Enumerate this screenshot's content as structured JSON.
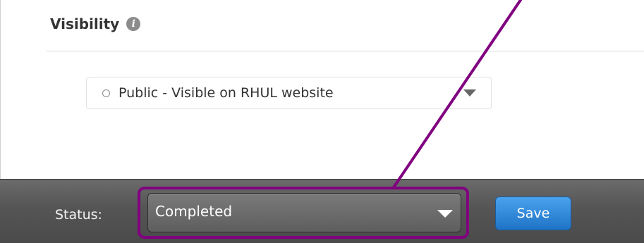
{
  "visibility": {
    "heading": "Visibility",
    "info_icon": "info-icon",
    "selected": "Public - Visible on RHUL website",
    "caret_icon": "chevron-down-icon"
  },
  "status_bar": {
    "label": "Status:",
    "selected": "Completed",
    "caret_icon": "chevron-down-icon",
    "save_label": "Save"
  },
  "colors": {
    "annotation": "#800080",
    "save_button": "#2a80d6",
    "status_bar": "#555555"
  }
}
